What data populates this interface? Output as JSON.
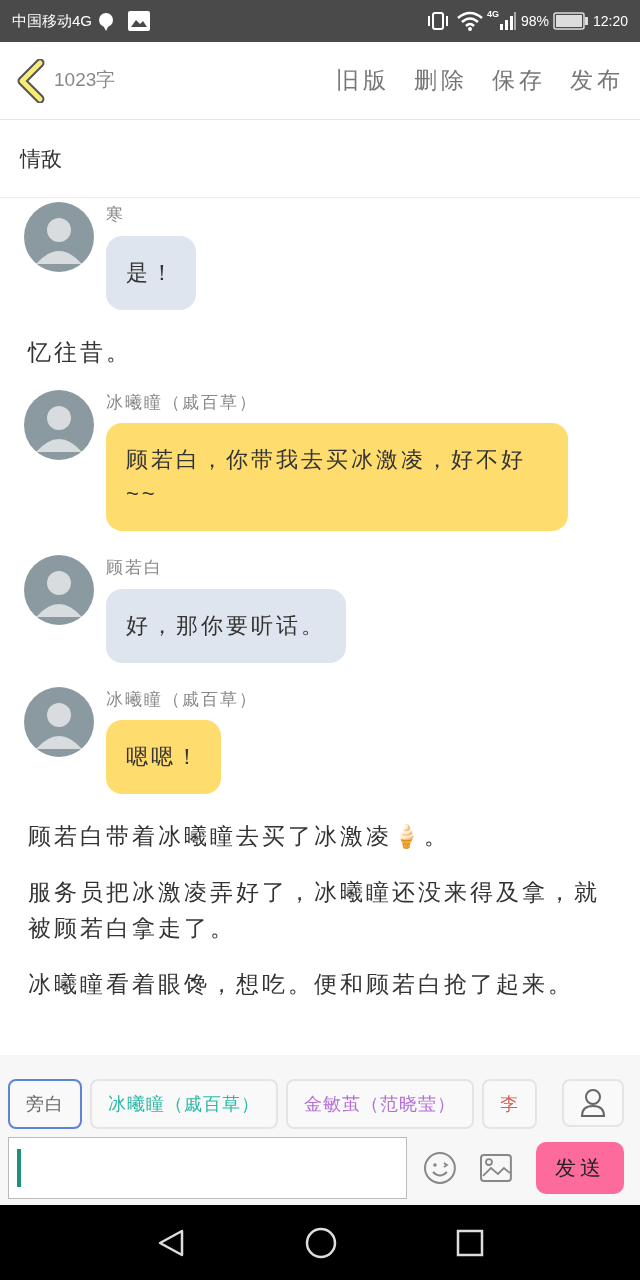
{
  "status_bar": {
    "carrier": "中国移动4G",
    "network": "4G",
    "battery": "98%",
    "time": "12:20"
  },
  "header": {
    "word_count": "1023字",
    "actions": [
      "旧版",
      "删除",
      "保存",
      "发布"
    ]
  },
  "title": "情敌",
  "feed": [
    {
      "kind": "message",
      "sender": "寒",
      "text": "是！",
      "color": "#dfe5ee"
    },
    {
      "kind": "narration",
      "text": "忆往昔。"
    },
    {
      "kind": "message",
      "sender": "冰曦瞳（戚百草）",
      "text": "顾若白，你带我去买冰激凌，好不好~~",
      "color": "#ffdc6e"
    },
    {
      "kind": "message",
      "sender": "顾若白",
      "text": "好，那你要听话。",
      "color": "#dfe5ee"
    },
    {
      "kind": "message",
      "sender": "冰曦瞳（戚百草）",
      "text": "嗯嗯！",
      "color": "#ffdc6e"
    },
    {
      "kind": "narration",
      "text": "顾若白带着冰曦瞳去买了冰激凌🍦。"
    },
    {
      "kind": "narration",
      "text": "服务员把冰激凌弄好了，冰曦瞳还没来得及拿，就被顾若白拿走了。"
    },
    {
      "kind": "narration",
      "text": "冰曦瞳看着眼馋，想吃。便和顾若白抢了起来。"
    }
  ],
  "roles": [
    {
      "label": "旁白",
      "color": "#666666",
      "selected": true
    },
    {
      "label": "冰曦瞳（戚百草）",
      "color": "#2bb8a6",
      "selected": false
    },
    {
      "label": "金敏茧（范晓莹）",
      "color": "#b46fd6",
      "selected": false
    },
    {
      "label": "李",
      "color": "#e05a4f",
      "selected": false
    }
  ],
  "send_button": "发送"
}
